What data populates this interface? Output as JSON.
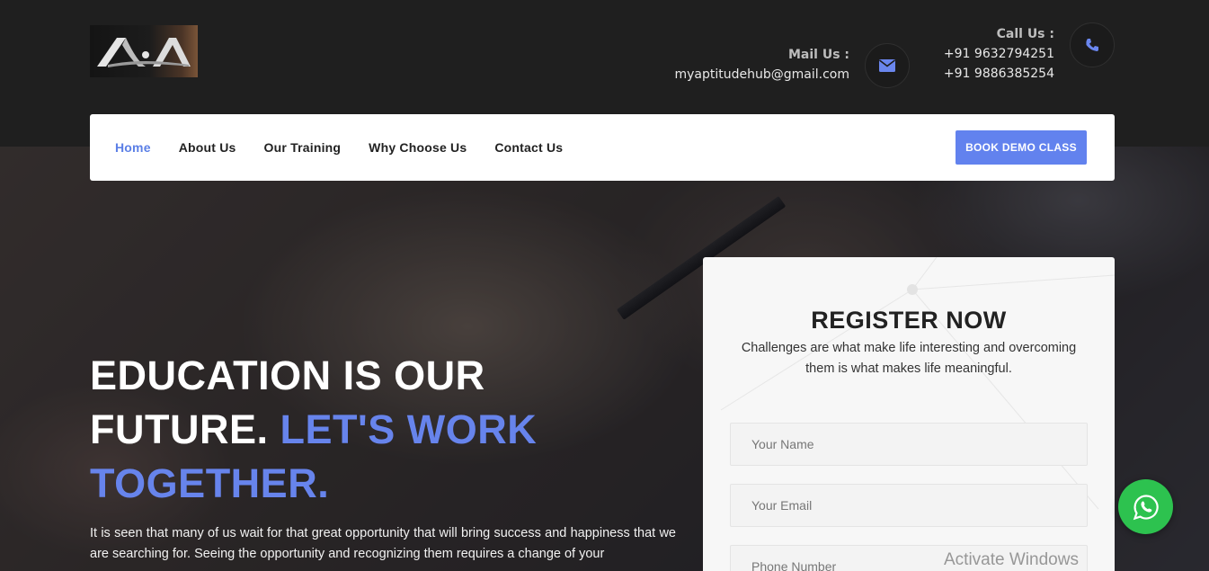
{
  "header": {
    "mail_label": "Mail Us :",
    "mail_value": "myaptitudehub@gmail.com",
    "call_label": "Call Us :",
    "phone_1": "+91 9632794251",
    "phone_2": "+91 9886385254"
  },
  "nav": {
    "items": [
      {
        "label": "Home",
        "active": true
      },
      {
        "label": "About Us",
        "active": false
      },
      {
        "label": "Our Training",
        "active": false
      },
      {
        "label": "Why Choose Us",
        "active": false
      },
      {
        "label": "Contact Us",
        "active": false
      }
    ],
    "cta": "BOOK DEMO CLASS"
  },
  "hero": {
    "headline_line1": "EDUCATION IS OUR",
    "headline_line2_white": "FUTURE.",
    "headline_line2_accent": "LET'S WORK",
    "headline_line3_accent": "TOGETHER.",
    "paragraph": "It is seen that many of us wait for that great opportunity that will bring success and happiness that we are searching for. Seeing the opportunity and recognizing them requires a change of your"
  },
  "register": {
    "title": "REGISTER NOW",
    "subtitle": "Challenges are what make life interesting and overcoming them is what makes life meaningful.",
    "name_placeholder": "Your Name",
    "email_placeholder": "Your Email",
    "phone_placeholder": "Phone Number"
  },
  "system": {
    "watermark": "Activate Windows"
  },
  "colors": {
    "accent": "#6282ee",
    "topbar": "#1f1f1f",
    "whatsapp": "#2dc24f"
  },
  "icons": {
    "mail": "envelope-icon",
    "phone": "phone-icon",
    "chat": "whatsapp-icon"
  }
}
